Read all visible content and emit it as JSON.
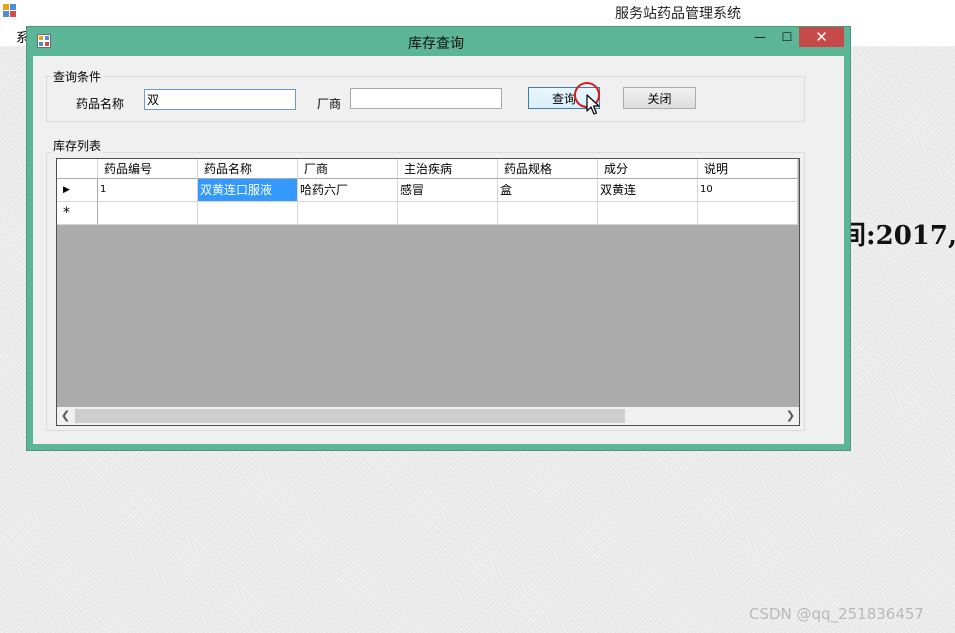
{
  "app": {
    "title": "服务站药品管理系统",
    "menu_partial": "系"
  },
  "background": {
    "text_partial": "间:2017,"
  },
  "dialog": {
    "title": "库存查询",
    "window_buttons": {
      "minimize": "—",
      "maximize": "☐",
      "close": "✕"
    },
    "query_group": {
      "title": "查询条件",
      "name_label": "药品名称",
      "name_value": "双",
      "manufacturer_label": "厂商",
      "manufacturer_value": "",
      "query_button": "查询",
      "close_button": "关闭"
    },
    "list_group": {
      "title": "库存列表",
      "columns": [
        "药品编号",
        "药品名称",
        "厂商",
        "主治疾病",
        "药品规格",
        "成分",
        "说明"
      ],
      "rows": [
        [
          "1",
          "双黄连口服液",
          "哈药六厂",
          "感冒",
          "盒",
          "双黄连",
          "10"
        ]
      ],
      "current_row_marker": "▶",
      "new_row_marker": "*"
    }
  },
  "watermark": "CSDN @qq_251836457",
  "colors": {
    "dialog_frame": "#5cb596",
    "close_button": "#c74a4a",
    "selected_cell": "#3399ff",
    "grid_empty": "#ababab"
  }
}
